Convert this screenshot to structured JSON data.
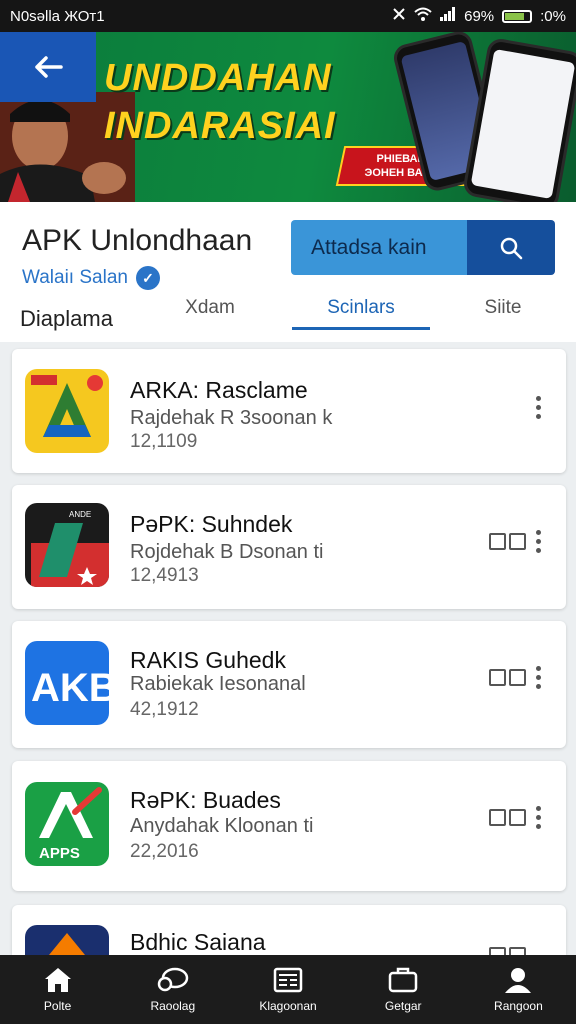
{
  "status_bar": {
    "left_text": "N0səlla ЖОт1",
    "signal_text": "ⅡⅡ",
    "battery_text": "69%",
    "time_text": ":0%",
    "battery_level": 0.8
  },
  "banner": {
    "title_line1": "UNDDAHAN",
    "title_line2": "INDARASIAI",
    "badge_line1": "РНІЕВАЦКИ",
    "badge_line2": "ЭОНЕН ВАНИА"
  },
  "header": {
    "title": "APK Unlondhaan",
    "subtitle": "Walaiı Salan",
    "download_label": "Attadsa kain",
    "section_label": "Diaplama"
  },
  "tabs": [
    {
      "label": "Xdam"
    },
    {
      "label": "Scinlars"
    },
    {
      "label": "Siite"
    }
  ],
  "apps": [
    {
      "name": "ARKA: Rasclame",
      "desc": "Rajdehak R 3soonan k",
      "count": "12,1109"
    },
    {
      "name": "PəPK: Suhndek",
      "desc": "Rojdehak B Dsonan ti",
      "count": "12,4913"
    },
    {
      "name": "RAKIS Guhedk",
      "desc": "Rabiekak Iesonanal",
      "count": "42,1912"
    },
    {
      "name": "RəPK: Buades",
      "desc": "Anydahak Kloonan ti",
      "count": "22,2016"
    },
    {
      "name": "Bdhic Saiana",
      "desc": "",
      "count": ""
    }
  ],
  "icons": {
    "app2_text": "ANDE",
    "app3_text": "AKB",
    "app4_text": "APPS"
  },
  "nav": [
    {
      "label": "Polte",
      "icon": "home-icon"
    },
    {
      "label": "Raoolag",
      "icon": "chat-icon"
    },
    {
      "label": "Klagoonan",
      "icon": "newspaper-icon"
    },
    {
      "label": "Getgar",
      "icon": "briefcase-icon"
    },
    {
      "label": "Rangoon",
      "icon": "profile-icon"
    }
  ],
  "colors": {
    "accent": "#1d65b5",
    "download_button": "#3a95d8",
    "search_button": "#154f9c",
    "banner_green": "#0e8a3e",
    "banner_yellow": "#ffd21f"
  }
}
